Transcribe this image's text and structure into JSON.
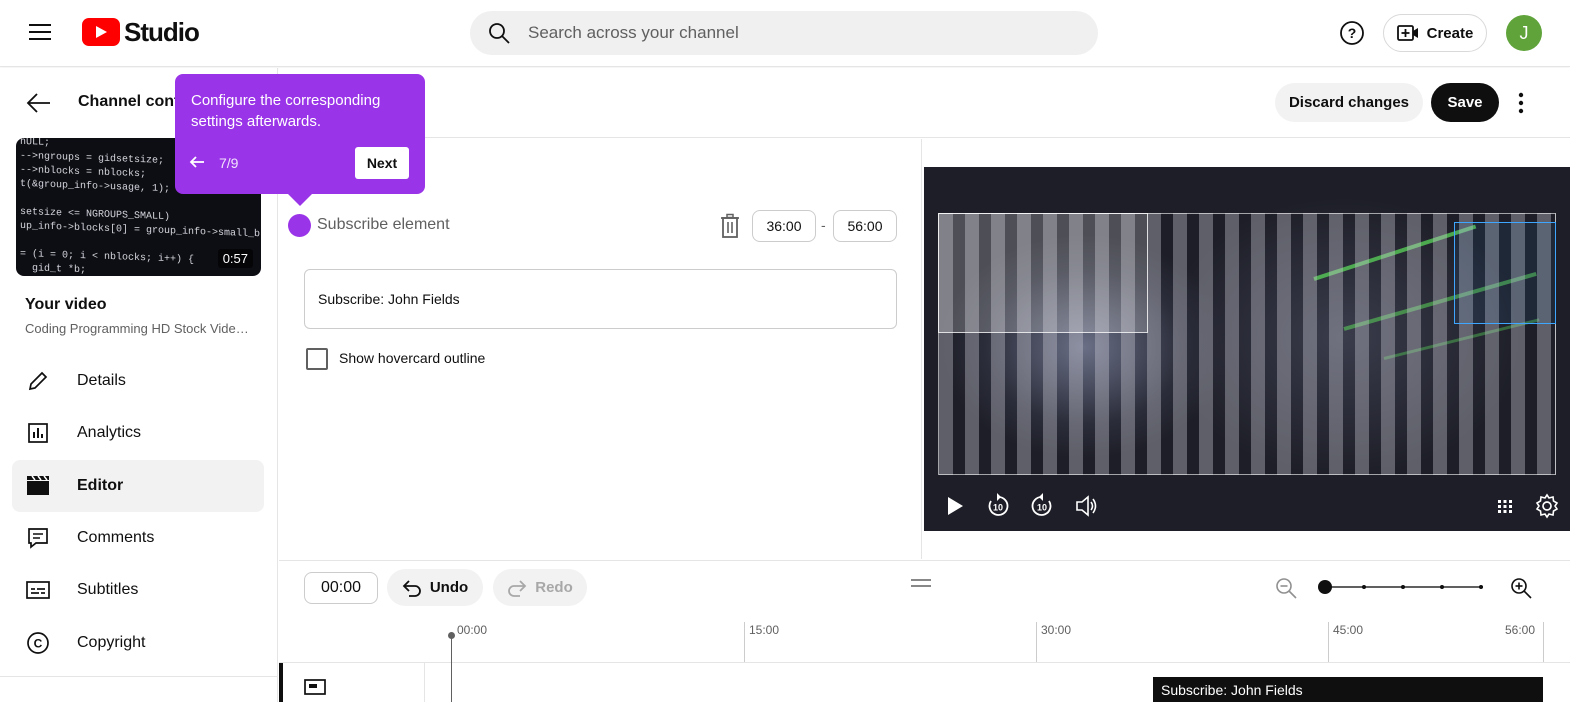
{
  "app": {
    "logo_text": "Studio",
    "search_placeholder": "Search across your channel",
    "create_label": "Create",
    "avatar_initial": "J"
  },
  "sidebar": {
    "channel_title": "Channel cont",
    "thumbnail_duration": "0:57",
    "your_video_label": "Your video",
    "video_title": "Coding Programming HD Stock Video Footage",
    "items": [
      {
        "label": "Details",
        "icon": "pencil-icon",
        "active": false
      },
      {
        "label": "Analytics",
        "icon": "analytics-icon",
        "active": false
      },
      {
        "label": "Editor",
        "icon": "clapper-icon",
        "active": true
      },
      {
        "label": "Comments",
        "icon": "comment-icon",
        "active": false
      },
      {
        "label": "Subtitles",
        "icon": "subtitles-icon",
        "active": false
      },
      {
        "label": "Copyright",
        "icon": "copyright-icon",
        "active": false
      }
    ]
  },
  "header": {
    "title_fragment": "n",
    "discard_label": "Discard changes",
    "save_label": "Save"
  },
  "tooltip": {
    "text": "Configure the corresponding settings afterwards.",
    "step": "7/9",
    "next_label": "Next"
  },
  "element_editor": {
    "element_name": "Subscribe element",
    "start_time": "36:00",
    "separator": "-",
    "end_time": "56:00",
    "subscribe_text": "Subscribe: John Fields",
    "hovercard_label": "Show hovercard outline",
    "hovercard_checked": false
  },
  "timeline": {
    "current_time": "00:00",
    "undo_label": "Undo",
    "redo_label": "Redo",
    "ruler_labels": [
      "00:00",
      "15:00",
      "30:00",
      "45:00",
      "56:00"
    ],
    "clip_label": "Subscribe: John Fields",
    "zoom_level": 0
  },
  "colors": {
    "accent_purple": "#9a34e8",
    "brand_red": "#ff0000",
    "avatar_green": "#5fa33a",
    "selection_blue": "#3ea6ff"
  }
}
